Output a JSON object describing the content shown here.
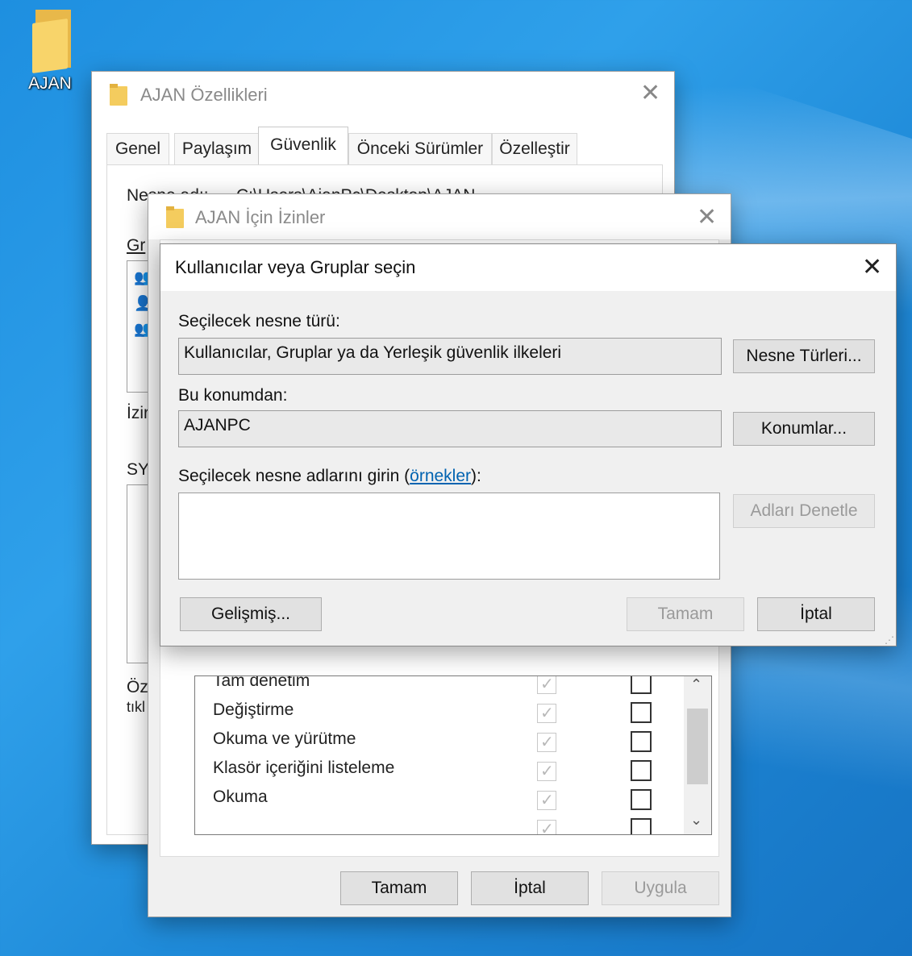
{
  "desktop": {
    "icon_label": "AJAN"
  },
  "properties_window": {
    "title": "AJAN Özellikleri",
    "tabs": [
      "Genel",
      "Paylaşım",
      "Güvenlik",
      "Önceki Sürümler",
      "Özelleştir"
    ],
    "active_tab": "Güvenlik",
    "object_name_label": "Nesne adı:",
    "object_name_value": "C:\\Users\\AjanPc\\Desktop\\AJAN",
    "partial_labels": {
      "groups": "Gr",
      "permissions": "İzir",
      "system": "SY",
      "special_line1": "Öz",
      "special_line2": "tıkl"
    }
  },
  "permissions_window": {
    "title": "AJAN İçin İzinler",
    "permissions": [
      {
        "name": "Tam denetim"
      },
      {
        "name": "Değiştirme"
      },
      {
        "name": "Okuma ve yürütme"
      },
      {
        "name": "Klasör içeriğini listeleme"
      },
      {
        "name": "Okuma"
      }
    ],
    "buttons": {
      "ok": "Tamam",
      "cancel": "İptal",
      "apply": "Uygula"
    }
  },
  "select_dialog": {
    "title": "Kullanıcılar veya Gruplar seçin",
    "object_type_label": "Seçilecek nesne türü:",
    "object_type_value": "Kullanıcılar, Gruplar ya da Yerleşik güvenlik ilkeleri",
    "object_types_button": "Nesne Türleri...",
    "location_label": "Bu konumdan:",
    "location_value": "AJANPC",
    "locations_button": "Konumlar...",
    "names_label_prefix": "Seçilecek nesne adlarını girin (",
    "names_label_link": "örnekler",
    "names_label_suffix": "):",
    "names_input_value": "",
    "check_names_button": "Adları Denetle",
    "advanced_button": "Gelişmiş...",
    "ok_button": "Tamam",
    "cancel_button": "İptal"
  }
}
